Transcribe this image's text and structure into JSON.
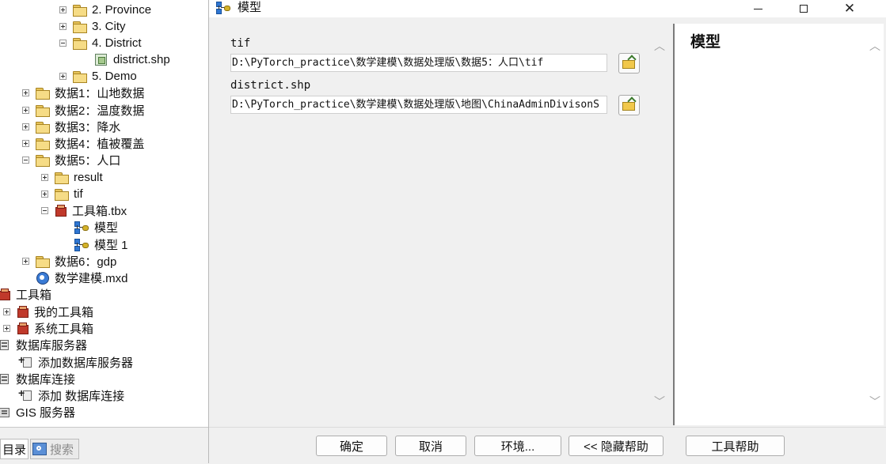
{
  "catalog": {
    "tree": [
      {
        "label": "2. Province",
        "expander": "plus",
        "icon": "folder-icon"
      },
      {
        "label": "3. City",
        "expander": "plus",
        "icon": "folder-icon"
      },
      {
        "label": "4. District",
        "expander": "minus",
        "icon": "folder-icon"
      },
      {
        "label": "district.shp",
        "expander": "",
        "icon": "shapefile-icon"
      },
      {
        "label": "5. Demo",
        "expander": "plus",
        "icon": "folder-icon"
      },
      {
        "label": "数据1：山地数据",
        "expander": "plus",
        "icon": "folder-icon"
      },
      {
        "label": "数据2：温度数据",
        "expander": "plus",
        "icon": "folder-icon"
      },
      {
        "label": "数据3：降水",
        "expander": "plus",
        "icon": "folder-icon"
      },
      {
        "label": "数据4：植被覆盖",
        "expander": "plus",
        "icon": "folder-icon"
      },
      {
        "label": "数据5：人口",
        "expander": "minus",
        "icon": "folder-icon"
      },
      {
        "label": "result",
        "expander": "plus",
        "icon": "folder-icon"
      },
      {
        "label": "tif",
        "expander": "plus",
        "icon": "folder-icon"
      },
      {
        "label": "工具箱.tbx",
        "expander": "minus",
        "icon": "toolbox-icon"
      },
      {
        "label": "模型",
        "expander": "",
        "icon": "model-icon"
      },
      {
        "label": "模型 1",
        "expander": "",
        "icon": "model-icon"
      },
      {
        "label": "数据6：gdp",
        "expander": "plus",
        "icon": "folder-icon"
      },
      {
        "label": "数学建模.mxd",
        "expander": "",
        "icon": "map-document-icon"
      },
      {
        "label": "工具箱",
        "expander": "",
        "icon": "toolbox-icon"
      },
      {
        "label": "我的工具箱",
        "expander": "plus",
        "icon": "toolbox-icon"
      },
      {
        "label": "系统工具箱",
        "expander": "plus",
        "icon": "toolbox-icon"
      },
      {
        "label": "数据库服务器",
        "expander": "",
        "icon": "database-server-icon"
      },
      {
        "label": "添加数据库服务器",
        "expander": "",
        "icon": "add-database-server-icon"
      },
      {
        "label": "数据库连接",
        "expander": "",
        "icon": "database-connection-icon"
      },
      {
        "label": "添加 数据库连接",
        "expander": "",
        "icon": "add-database-connection-icon"
      },
      {
        "label": "GIS 服务器",
        "expander": "",
        "icon": "gis-server-icon"
      }
    ],
    "tabs": {
      "catalog": "目录",
      "search": "搜索"
    }
  },
  "dialog": {
    "title": "模型",
    "params": [
      {
        "label": "tif",
        "value": "D:\\PyTorch_practice\\数学建模\\数据处理版\\数据5：人口\\tif"
      },
      {
        "label": "district.shp",
        "value": "D:\\PyTorch_practice\\数学建模\\数据处理版\\地图\\ChinaAdminDivisonS"
      }
    ],
    "help_title": "模型",
    "buttons": {
      "ok": "确定",
      "cancel": "取消",
      "env": "环境...",
      "hide_help": "<< 隐藏帮助",
      "tool_help": "工具帮助"
    },
    "scroll_up": "︿",
    "scroll_down": "﹀",
    "close_glyph": "✕"
  }
}
